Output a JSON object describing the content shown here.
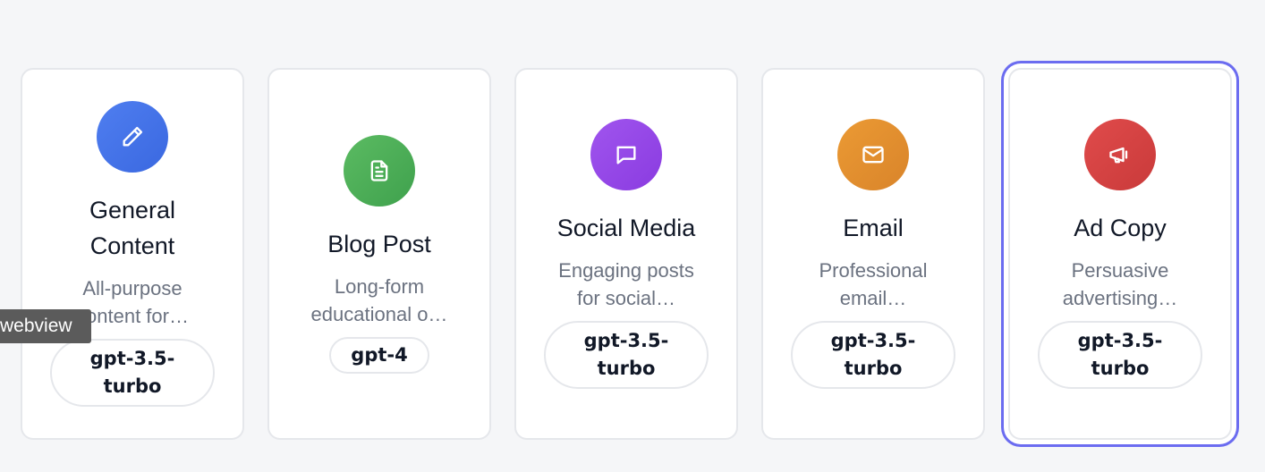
{
  "cards": [
    {
      "title": "General Content",
      "description": "All-purpose content for…",
      "model": "gpt-3.5-turbo",
      "icon": "pencil-icon",
      "color_start": "#4f7ef0",
      "color_end": "#3a68e0"
    },
    {
      "title": "Blog Post",
      "description": "Long-form educational o…",
      "model": "gpt-4",
      "icon": "document-icon",
      "color_start": "#5bbb62",
      "color_end": "#3fa14d"
    },
    {
      "title": "Social Media",
      "description": "Engaging posts for social…",
      "model": "gpt-3.5-turbo",
      "icon": "message-icon",
      "color_start": "#a055ee",
      "color_end": "#8a3be0"
    },
    {
      "title": "Email",
      "description": "Professional email…",
      "model": "gpt-3.5-turbo",
      "icon": "mail-icon",
      "color_start": "#eb9a34",
      "color_end": "#d9842a"
    },
    {
      "title": "Ad Copy",
      "description": "Persuasive advertising…",
      "model": "gpt-3.5-turbo",
      "icon": "megaphone-icon",
      "color_start": "#e04b4b",
      "color_end": "#c93a3a",
      "selected": true
    }
  ],
  "tooltip": "webview",
  "colors": {
    "selection_ring": "#6b6cf0",
    "background": "#f5f6f8"
  }
}
